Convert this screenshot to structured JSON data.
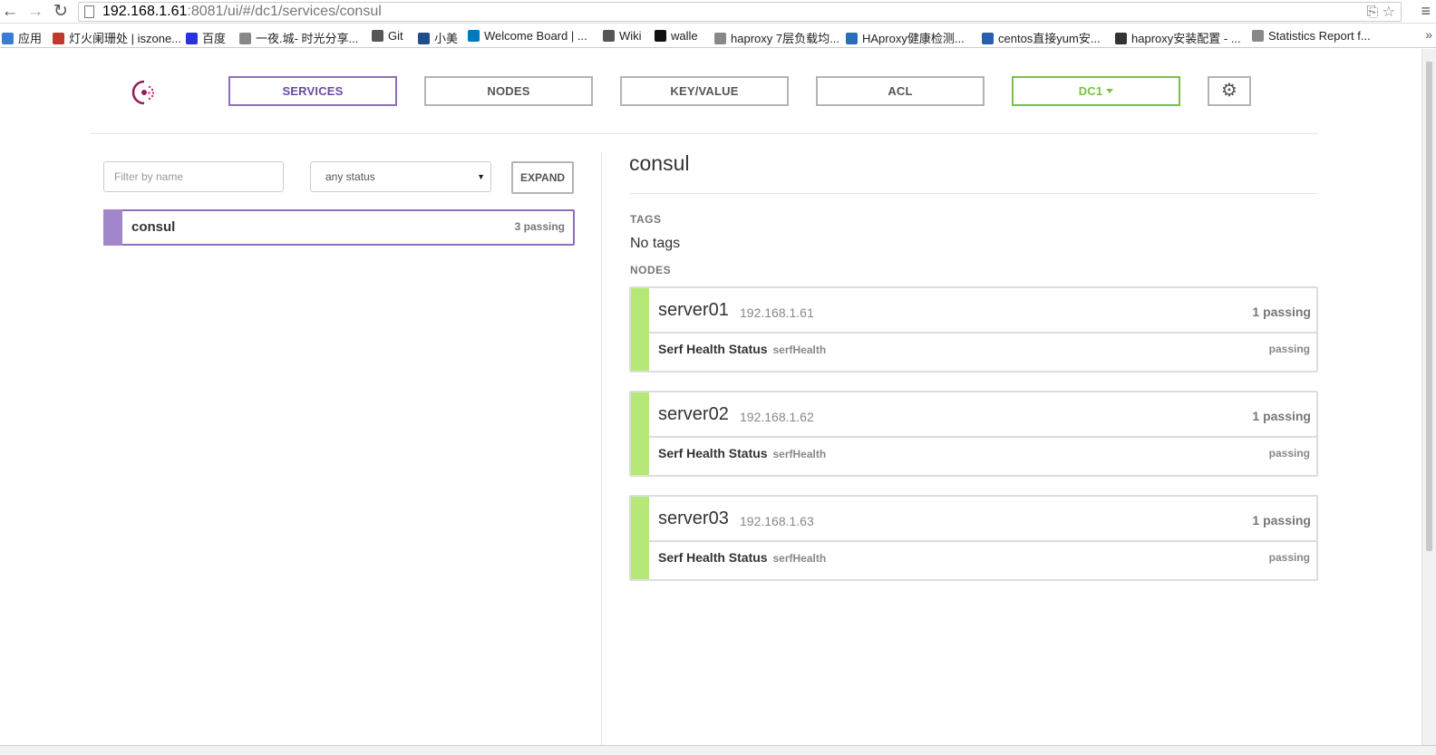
{
  "browser": {
    "url_host": "192.168.1.61",
    "url_rest": ":8081/ui/#/dc1/services/consul",
    "bookmarks": [
      {
        "label": "应用",
        "color": "#3a7bd5"
      },
      {
        "label": "灯火阑珊处 | iszone...",
        "color": "#c0392b"
      },
      {
        "label": "百度",
        "color": "#2932e1"
      },
      {
        "label": "一夜.城- 时光分享...",
        "color": "#888888"
      },
      {
        "label": "Git",
        "color": "#555555"
      },
      {
        "label": "小美",
        "color": "#1f4e8c"
      },
      {
        "label": "Welcome Board | ...",
        "color": "#0079bf"
      },
      {
        "label": "Wiki",
        "color": "#555555"
      },
      {
        "label": "walle",
        "color": "#111111"
      },
      {
        "label": "haproxy 7层负载均...",
        "color": "#888888"
      },
      {
        "label": "HAproxy健康检测...",
        "color": "#2a6ebb"
      },
      {
        "label": "centos直接yum安...",
        "color": "#2a5db0"
      },
      {
        "label": "haproxy安装配置 - ...",
        "color": "#333333"
      },
      {
        "label": "Statistics Report f...",
        "color": "#888888"
      }
    ]
  },
  "nav": {
    "services": "SERVICES",
    "nodes": "NODES",
    "kv": "KEY/VALUE",
    "acl": "ACL",
    "dc": "DC1"
  },
  "filter": {
    "placeholder": "Filter by name",
    "status": "any status",
    "expand": "EXPAND"
  },
  "services": [
    {
      "name": "consul",
      "count": "3 passing"
    }
  ],
  "detail": {
    "title": "consul",
    "tags_label": "TAGS",
    "tags_value": "No tags",
    "nodes_label": "NODES",
    "nodes": [
      {
        "name": "server01",
        "address": "192.168.1.61",
        "passing": "1 passing",
        "check_name": "Serf Health Status",
        "check_id": "serfHealth",
        "check_status": "passing"
      },
      {
        "name": "server02",
        "address": "192.168.1.62",
        "passing": "1 passing",
        "check_name": "Serf Health Status",
        "check_id": "serfHealth",
        "check_status": "passing"
      },
      {
        "name": "server03",
        "address": "192.168.1.63",
        "passing": "1 passing",
        "check_name": "Serf Health Status",
        "check_id": "serfHealth",
        "check_status": "passing"
      }
    ]
  },
  "colors": {
    "accent": "#8e6ebd",
    "passing": "#b6e878",
    "dc": "#7cc04a"
  }
}
